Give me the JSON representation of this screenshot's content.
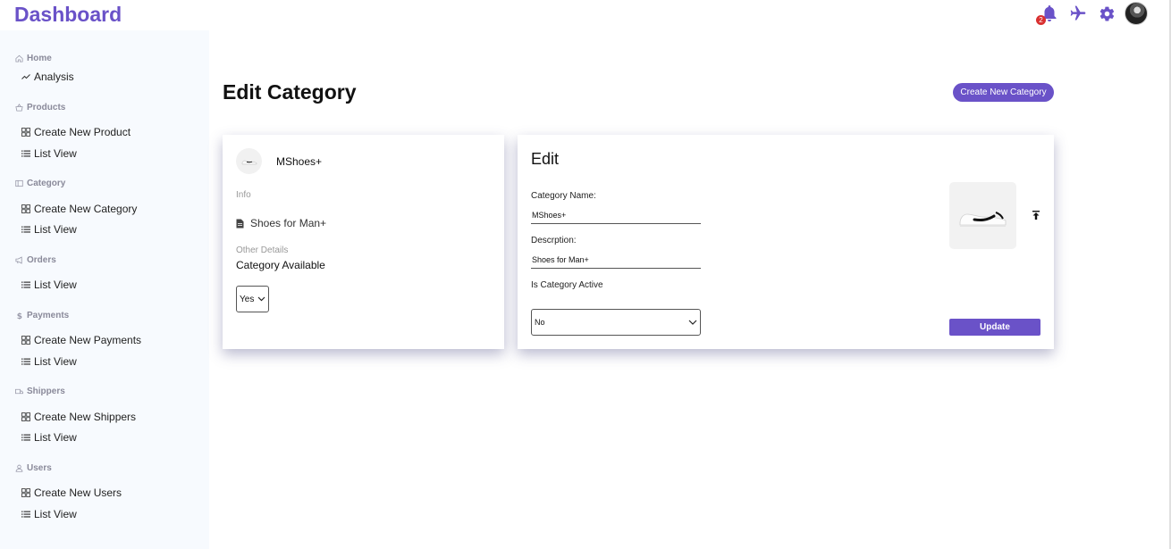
{
  "app": {
    "title": "Dashboard"
  },
  "header": {
    "notification_count": "2",
    "accent_color": "#6a52c8"
  },
  "sidebar": {
    "sections": [
      {
        "title": "Home",
        "icon": "home-icon",
        "links": [
          {
            "label": "Analysis",
            "icon": "trend-icon"
          }
        ]
      },
      {
        "title": "Products",
        "icon": "basket-icon",
        "links": [
          {
            "label": "Create New Product",
            "icon": "grid-icon"
          },
          {
            "label": "List View",
            "icon": "list-icon"
          }
        ]
      },
      {
        "title": "Category",
        "icon": "category-icon",
        "links": [
          {
            "label": "Create New Category",
            "icon": "grid-icon"
          },
          {
            "label": "List View",
            "icon": "list-icon"
          }
        ]
      },
      {
        "title": "Orders",
        "icon": "megaphone-icon",
        "links": [
          {
            "label": "List View",
            "icon": "list-icon"
          }
        ]
      },
      {
        "title": "Payments",
        "icon": "dollar-icon",
        "links": [
          {
            "label": "Create New Payments",
            "icon": "grid-icon"
          },
          {
            "label": "List View",
            "icon": "list-icon"
          }
        ]
      },
      {
        "title": "Shippers",
        "icon": "truck-icon",
        "links": [
          {
            "label": "Create New Shippers",
            "icon": "grid-icon"
          },
          {
            "label": "List View",
            "icon": "list-icon"
          }
        ]
      },
      {
        "title": "Users",
        "icon": "user-icon",
        "links": [
          {
            "label": "Create New Users",
            "icon": "grid-icon"
          },
          {
            "label": "List View",
            "icon": "list-icon"
          }
        ]
      }
    ]
  },
  "main": {
    "title": "Edit Category",
    "create_button": "Create New Category"
  },
  "summary_card": {
    "name": "MShoes+",
    "info_label": "Info",
    "description": "Shoes for Man+",
    "other_details_label": "Other Details",
    "availability_label": "Category Available",
    "availability_value": "Yes"
  },
  "edit_card": {
    "title": "Edit",
    "name_label": "Category Name:",
    "name_value": "MShoes+",
    "description_label": "Descrption:",
    "description_value": "Shoes for Man+",
    "active_label": "Is Category Active",
    "active_value": "No",
    "update_button": "Update"
  }
}
